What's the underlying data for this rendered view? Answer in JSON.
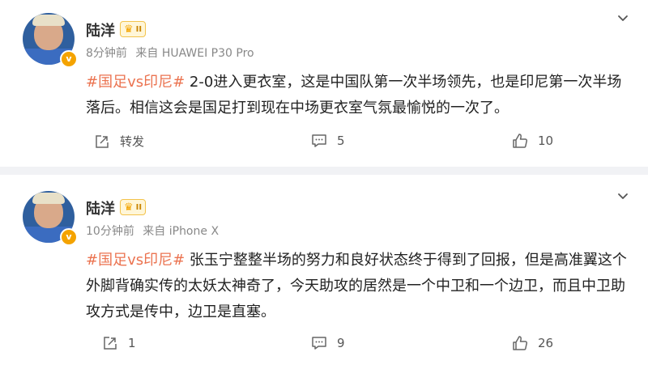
{
  "posts": [
    {
      "username": "陆洋",
      "level": "II",
      "time": "8分钟前",
      "source": "来自 HUAWEI P30 Pro",
      "topic": "#国足vs印尼#",
      "text": " 2-0进入更衣室，这是中国队第一次半场领先，也是印尼第一次半场落后。相信这会是国足打到现在中场更衣室气氛最愉悦的一次了。",
      "repost_label": "转发",
      "comments": "5",
      "likes": "10"
    },
    {
      "username": "陆洋",
      "level": "II",
      "time": "10分钟前",
      "source": "来自 iPhone X",
      "topic": "#国足vs印尼#",
      "text": " 张玉宁整整半场的努力和良好状态终于得到了回报，但是高准翼这个外脚背确实传的太妖太神奇了，今天助攻的居然是一个中卫和一个边卫，而且中卫助攻方式是传中，边卫是直塞。",
      "repost_label": "1",
      "comments": "9",
      "likes": "26"
    }
  ],
  "colors": {
    "accent": "#eb7350",
    "background": "#f1f2f5",
    "verified": "#f4a300"
  }
}
